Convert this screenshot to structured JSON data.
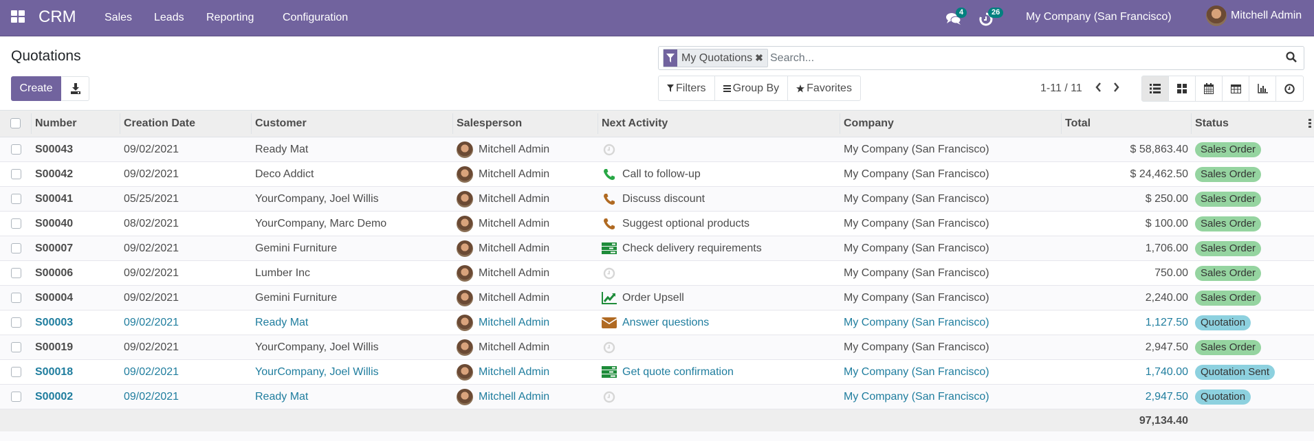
{
  "navbar": {
    "app_name": "CRM",
    "menus": [
      "Sales",
      "Leads",
      "Reporting",
      "Configuration"
    ],
    "messages_count": "4",
    "activities_count": "26",
    "company": "My Company (San Francisco)",
    "user": "Mitchell Admin",
    "colors": {
      "brand": "#71639e",
      "badge": "#00807f"
    }
  },
  "control_panel": {
    "title": "Quotations",
    "create_label": "Create",
    "download_icon": "download-icon",
    "search": {
      "facet_label": "My Quotations",
      "placeholder": "Search..."
    },
    "filters": [
      {
        "label": "Filters",
        "icon": "filter-icon"
      },
      {
        "label": "Group By",
        "icon": "bars-icon"
      },
      {
        "label": "Favorites",
        "icon": "star-icon"
      }
    ],
    "pager": "1-11 / 11",
    "views": [
      "list",
      "kanban",
      "calendar",
      "pivot",
      "graph",
      "activity"
    ],
    "active_view": "list"
  },
  "table": {
    "columns": [
      "Number",
      "Creation Date",
      "Customer",
      "Salesperson",
      "Next Activity",
      "Company",
      "Total",
      "Status"
    ],
    "rows": [
      {
        "number": "S00043",
        "date": "09/02/2021",
        "customer": "Ready Mat",
        "salesperson": "Mitchell Admin",
        "activity_icon": "clock",
        "activity": "",
        "company": "My Company (San Francisco)",
        "total": "$ 58,863.40",
        "status": "Sales Order",
        "status_type": "success",
        "highlight": false
      },
      {
        "number": "S00042",
        "date": "09/02/2021",
        "customer": "Deco Addict",
        "salesperson": "Mitchell Admin",
        "activity_icon": "phone-green",
        "activity": "Call to follow-up",
        "company": "My Company (San Francisco)",
        "total": "$ 24,462.50",
        "status": "Sales Order",
        "status_type": "success",
        "highlight": false
      },
      {
        "number": "S00041",
        "date": "05/25/2021",
        "customer": "YourCompany, Joel Willis",
        "salesperson": "Mitchell Admin",
        "activity_icon": "phone-orange",
        "activity": "Discuss discount",
        "company": "My Company (San Francisco)",
        "total": "$ 250.00",
        "status": "Sales Order",
        "status_type": "success",
        "highlight": false
      },
      {
        "number": "S00040",
        "date": "08/02/2021",
        "customer": "YourCompany, Marc Demo",
        "salesperson": "Mitchell Admin",
        "activity_icon": "phone-orange",
        "activity": "Suggest optional products",
        "company": "My Company (San Francisco)",
        "total": "$ 100.00",
        "status": "Sales Order",
        "status_type": "success",
        "highlight": false
      },
      {
        "number": "S00007",
        "date": "09/02/2021",
        "customer": "Gemini Furniture",
        "salesperson": "Mitchell Admin",
        "activity_icon": "tasks-green",
        "activity": "Check delivery requirements",
        "company": "My Company (San Francisco)",
        "total": "1,706.00",
        "status": "Sales Order",
        "status_type": "success",
        "highlight": false
      },
      {
        "number": "S00006",
        "date": "09/02/2021",
        "customer": "Lumber Inc",
        "salesperson": "Mitchell Admin",
        "activity_icon": "clock",
        "activity": "",
        "company": "My Company (San Francisco)",
        "total": "750.00",
        "status": "Sales Order",
        "status_type": "success",
        "highlight": false
      },
      {
        "number": "S00004",
        "date": "09/02/2021",
        "customer": "Gemini Furniture",
        "salesperson": "Mitchell Admin",
        "activity_icon": "chart-green",
        "activity": "Order Upsell",
        "company": "My Company (San Francisco)",
        "total": "2,240.00",
        "status": "Sales Order",
        "status_type": "success",
        "highlight": false
      },
      {
        "number": "S00003",
        "date": "09/02/2021",
        "customer": "Ready Mat",
        "salesperson": "Mitchell Admin",
        "activity_icon": "envelope-orange",
        "activity": "Answer questions",
        "company": "My Company (San Francisco)",
        "total": "1,127.50",
        "status": "Quotation",
        "status_type": "info",
        "highlight": true
      },
      {
        "number": "S00019",
        "date": "09/02/2021",
        "customer": "YourCompany, Joel Willis",
        "salesperson": "Mitchell Admin",
        "activity_icon": "clock",
        "activity": "",
        "company": "My Company (San Francisco)",
        "total": "2,947.50",
        "status": "Sales Order",
        "status_type": "success",
        "highlight": false
      },
      {
        "number": "S00018",
        "date": "09/02/2021",
        "customer": "YourCompany, Joel Willis",
        "salesperson": "Mitchell Admin",
        "activity_icon": "tasks-green",
        "activity": "Get quote confirmation",
        "company": "My Company (San Francisco)",
        "total": "1,740.00",
        "status": "Quotation Sent",
        "status_type": "info",
        "highlight": true
      },
      {
        "number": "S00002",
        "date": "09/02/2021",
        "customer": "Ready Mat",
        "salesperson": "Mitchell Admin",
        "activity_icon": "clock",
        "activity": "",
        "company": "My Company (San Francisco)",
        "total": "2,947.50",
        "status": "Quotation",
        "status_type": "info",
        "highlight": true
      }
    ],
    "sum_total": "97,134.40",
    "colors": {
      "success": "#95d4a0",
      "info": "#8dd1df",
      "link": "#1f7d9e"
    }
  }
}
